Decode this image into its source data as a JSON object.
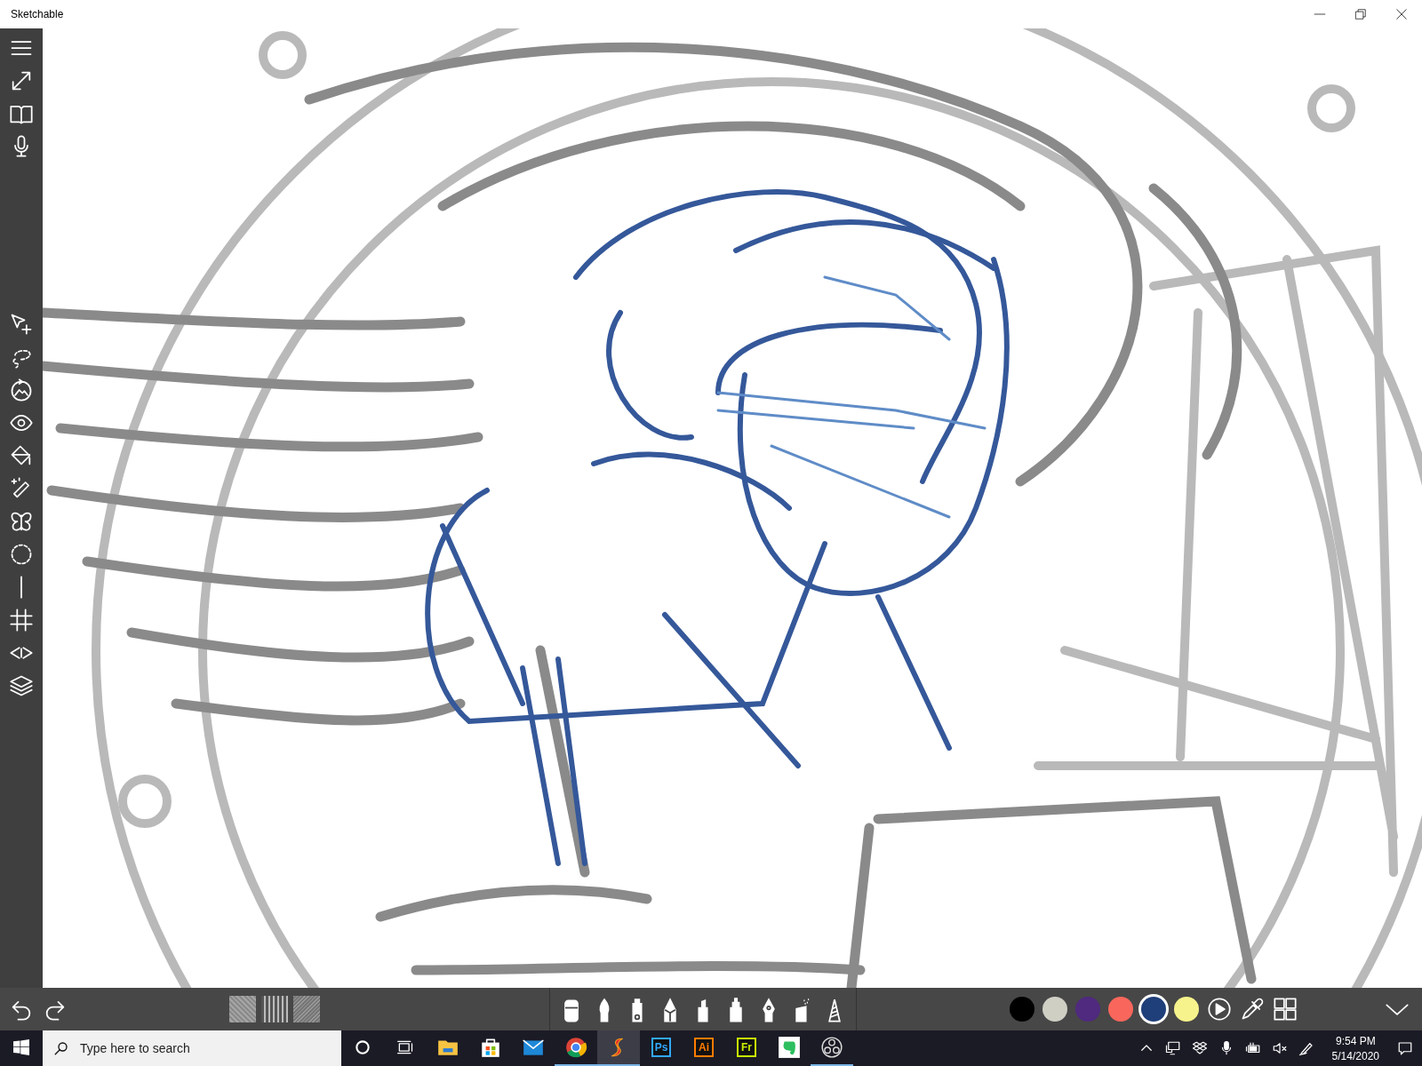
{
  "window": {
    "title": "Sketchable"
  },
  "bottom_toolbar": {
    "papers": [
      {
        "selected": false
      },
      {
        "selected": false
      },
      {
        "selected": false
      }
    ],
    "colors": [
      {
        "color": "#000000",
        "selected": false
      },
      {
        "color": "#cfcfc4",
        "selected": false
      },
      {
        "color": "#4f2a7f",
        "selected": false
      },
      {
        "color": "#f9675c",
        "selected": false
      },
      {
        "color": "#1f3f7a",
        "selected": true
      },
      {
        "color": "#f7f38c",
        "selected": false
      }
    ]
  },
  "taskbar": {
    "search": {
      "placeholder": "Type here to search"
    },
    "apps": [
      {
        "kind": "explorer",
        "running": false,
        "active": false
      },
      {
        "kind": "store",
        "running": false,
        "active": false
      },
      {
        "kind": "mail",
        "running": false,
        "active": false
      },
      {
        "kind": "chrome",
        "running": true,
        "active": false
      },
      {
        "kind": "sketchable",
        "running": true,
        "active": true
      },
      {
        "kind": "badge",
        "label": "Ps",
        "color": "#31a8ff",
        "running": false,
        "active": false
      },
      {
        "kind": "badge",
        "label": "Ai",
        "color": "#ff7c00",
        "running": false,
        "active": false
      },
      {
        "kind": "badge",
        "label": "Fr",
        "color": "#c8f000",
        "running": false,
        "active": false
      },
      {
        "kind": "evernote",
        "running": false,
        "active": false
      },
      {
        "kind": "obs",
        "running": true,
        "active": false
      }
    ],
    "clock": {
      "time": "9:54 PM",
      "date": "5/14/2020"
    }
  }
}
